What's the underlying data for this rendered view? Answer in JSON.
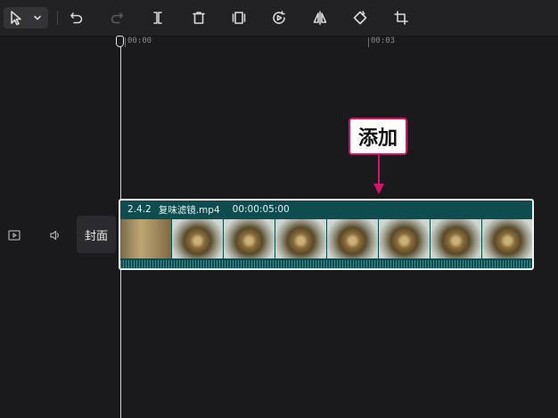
{
  "toolbar": {
    "tools": [
      {
        "name": "select-arrow-icon",
        "enabled": true
      },
      {
        "name": "undo-icon",
        "enabled": true
      },
      {
        "name": "redo-icon",
        "enabled": false
      },
      {
        "name": "split-icon",
        "enabled": true
      },
      {
        "name": "delete-icon",
        "enabled": true
      },
      {
        "name": "freeze-frame-icon",
        "enabled": true
      },
      {
        "name": "reverse-play-icon",
        "enabled": true
      },
      {
        "name": "mirror-icon",
        "enabled": true
      },
      {
        "name": "rotate-icon",
        "enabled": true
      },
      {
        "name": "crop-icon",
        "enabled": true
      }
    ]
  },
  "ruler": {
    "start_label": "00:00",
    "mid_label": "00:03"
  },
  "track": {
    "cover_label": "封面"
  },
  "clip": {
    "version": "2.4.2",
    "filename": "复味滤镜.mp4",
    "duration": "00:00:05:00",
    "frame_count": 8
  },
  "callout": {
    "label": "添加",
    "color": "#d4146a"
  },
  "colors": {
    "clip_background": "#0e4c4f",
    "timeline_background": "#1a1a1c"
  }
}
